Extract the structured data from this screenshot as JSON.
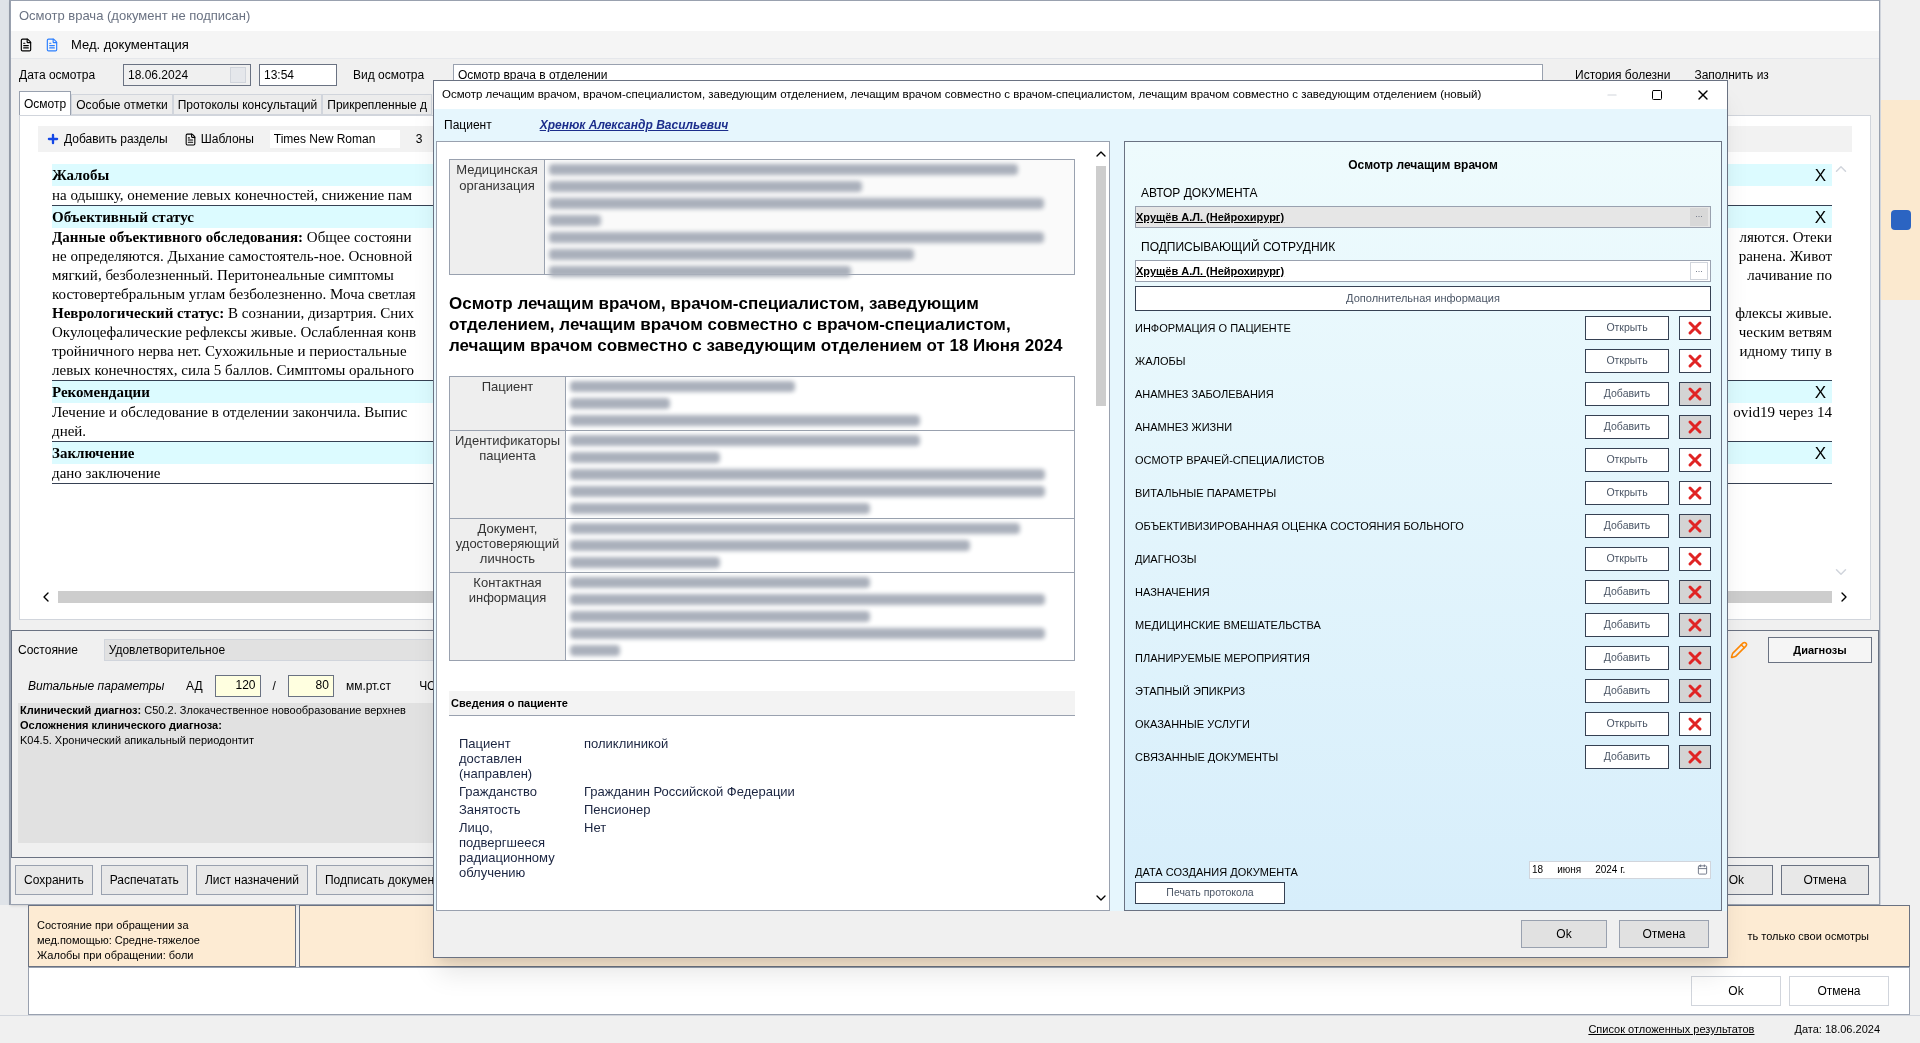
{
  "main_window": {
    "title": "Осмотр врача (документ не подписан)",
    "toolbar_label": "Мед. документация",
    "date_label": "Дата осмотра",
    "date_value": "18.06.2024",
    "time_value": "13:54",
    "exam_type_label": "Вид осмотра",
    "exam_type_value": "Осмотр врача в отделении",
    "history_link": "История болезни",
    "fill_from": "Заполнить из",
    "tabs": [
      {
        "label": "Осмотр",
        "selected": true
      },
      {
        "label": "Особые отметки",
        "selected": false
      },
      {
        "label": "Протоколы консультаций",
        "selected": false
      },
      {
        "label": "Прикрепленные д",
        "selected": false
      }
    ],
    "editor_toolbar": {
      "add_sections": "Добавить разделы",
      "templates": "Шаблоны",
      "font": "Times New Roman",
      "font_size": "3"
    },
    "sections": [
      {
        "heading": "Жалобы",
        "close": "X",
        "lines": [
          {
            "left": "на одышку, онемение левых конечностей, снижение пам"
          }
        ]
      },
      {
        "heading": "Объективный статус",
        "close": "X",
        "lines": [
          {
            "left": "**Данные объективного обследования:** Общее состояни",
            "right": "ляются. Отеки"
          },
          {
            "left": "не определяются. Дыхание самостоятель-ное. Основной",
            "right": "ранена. Живот"
          },
          {
            "left": "мягкий, безболезненный. Перитонеальные симптомы",
            "right": "лачивание по"
          },
          {
            "left": "костовертебральным углам безболезненно. Моча светлая"
          },
          {
            "left": "**Неврологический статус:** В сознании, дизартрия. Сних",
            "right": "флексы живые."
          },
          {
            "left": "Окулоцефалические рефлексы живые. Ослабленная конв",
            "right": "ческим ветвям"
          },
          {
            "left": "тройничного нерва нет. Сухожильные и периостальные",
            "right": "идному типу в"
          },
          {
            "left": "левых конечностях, сила 5 баллов. Симптомы орального"
          }
        ]
      },
      {
        "heading": "Рекомендации",
        "close": "X",
        "lines": [
          {
            "left": "Лечение и обследование в отделении закончила. Выпис",
            "right": "ovid19 через 14"
          },
          {
            "left": "дней."
          }
        ]
      },
      {
        "heading": "Заключение",
        "close": "X",
        "lines": [
          {
            "left": "дано заключение"
          }
        ]
      }
    ],
    "state_label": "Состояние",
    "state_value": "Удовлетворительное",
    "vitals_label": "Витальные параметры",
    "bp_label": "АД",
    "bp_sys": "120",
    "bp_sep": "/",
    "bp_dia": "80",
    "bp_unit": "мм.рт.ст",
    "hr_label": "ЧС",
    "diagnosis_lines": [
      "**Клинический диагноз:** C50.2. Злокачественное новообразование верхнев",
      "**Осложнения клинического диагноза:**",
      "K04.5. Хронический апикальный периодонтит"
    ],
    "diagnoses_button": "Диагнозы",
    "buttons": [
      "Сохранить",
      "Распечатать",
      "Лист назначений",
      "Подписать докумен"
    ],
    "right_buttons": [
      "Ok",
      "Отмена"
    ]
  },
  "note_panel": {
    "lines": [
      "Состояние при обращении за",
      "мед.помощью: Средне-тяжелое",
      "Жалобы при обращении: боли"
    ],
    "right_note": "ть только свои осмотры"
  },
  "back_dialog_buttons": [
    "Ok",
    "Отмена"
  ],
  "dialog": {
    "title": "Осмотр лечащим врачом, врачом-специалистом, заведующим отделением, лечащим врачом совместно с врачом-специалистом, лечащим врачом совместно с заведующим отделением (новый)",
    "patient_label": "Пациент",
    "patient_name": "Хренюк Александр Васильевич",
    "org_label": "Медицинская организация",
    "doc_heading": "Осмотр лечащим врачом, врачом-специалистом, заведующим отделением, лечащим врачом совместно с врачом-специалистом, лечащим врачом совместно с заведующим отделением от 18 Июня 2024",
    "patient_table": [
      {
        "label": "Пациент"
      },
      {
        "label": "Идентификаторы пациента"
      },
      {
        "label": "Документ, удостоверяющий личность"
      },
      {
        "label": "Контактная информация"
      }
    ],
    "info_header": "Сведения о пациенте",
    "info_rows": [
      {
        "label": "Пациент доставлен (направлен)",
        "value": "поликлиникой"
      },
      {
        "label": "Гражданство",
        "value": "Гражданин Российской Федерации"
      },
      {
        "label": "Занятость",
        "value": "Пенсионер"
      },
      {
        "label": "Лицо, подвергшееся радиационному облучению",
        "value": "Нет"
      }
    ],
    "panel_title": "Осмотр лечащим врачом",
    "author_label": "АВТОР ДОКУМЕНТА",
    "author_value": "Хрущёв А.Л. (Нейрохирург)",
    "author_disabled": true,
    "signer_label": "ПОДПИСЫВАЮЩИЙ СОТРУДНИК",
    "signer_value": "Хрущёв А.Л. (Нейрохирург)",
    "signer_disabled": false,
    "browse_label": "...",
    "extra_info": "Дополнительная информация",
    "sections": [
      {
        "name": "ИНФОРМАЦИЯ О ПАЦИЕНТЕ",
        "action": "Открыть",
        "filled": true
      },
      {
        "name": "ЖАЛОБЫ",
        "action": "Открыть",
        "filled": true
      },
      {
        "name": "АНАМНЕЗ ЗАБОЛЕВАНИЯ",
        "action": "Добавить",
        "filled": false
      },
      {
        "name": "АНАМНЕЗ ЖИЗНИ",
        "action": "Добавить",
        "filled": false
      },
      {
        "name": "ОСМОТР ВРАЧЕЙ-СПЕЦИАЛИСТОВ",
        "action": "Открыть",
        "filled": true
      },
      {
        "name": "ВИТАЛЬНЫЕ ПАРАМЕТРЫ",
        "action": "Открыть",
        "filled": true
      },
      {
        "name": "ОБЪЕКТИВИЗИРОВАННАЯ ОЦЕНКА СОСТОЯНИЯ БОЛЬНОГО",
        "action": "Добавить",
        "filled": false
      },
      {
        "name": "ДИАГНОЗЫ",
        "action": "Открыть",
        "filled": true
      },
      {
        "name": "НАЗНАЧЕНИЯ",
        "action": "Добавить",
        "filled": false
      },
      {
        "name": "МЕДИЦИНСКИЕ ВМЕШАТЕЛЬСТВА",
        "action": "Добавить",
        "filled": false
      },
      {
        "name": "ПЛАНИРУЕМЫЕ МЕРОПРИЯТИЯ",
        "action": "Добавить",
        "filled": false
      },
      {
        "name": "ЭТАПНЫЙ ЭПИКРИЗ",
        "action": "Добавить",
        "filled": false
      },
      {
        "name": "ОКАЗАННЫЕ УСЛУГИ",
        "action": "Открыть",
        "filled": true
      },
      {
        "name": "СВЯЗАННЫЕ ДОКУМЕНТЫ",
        "action": "Добавить",
        "filled": false
      }
    ],
    "date_label": "ДАТА СОЗДАНИЯ ДОКУМЕНТА",
    "date_day": "18",
    "date_month": "июня",
    "date_year": "2024 г.",
    "print_button": "Печать протокола",
    "ok": "Ok",
    "cancel": "Отмена"
  },
  "status_bar": {
    "deferred_link": "Список отложенных результатов",
    "date": "Дата: 18.06.2024"
  }
}
